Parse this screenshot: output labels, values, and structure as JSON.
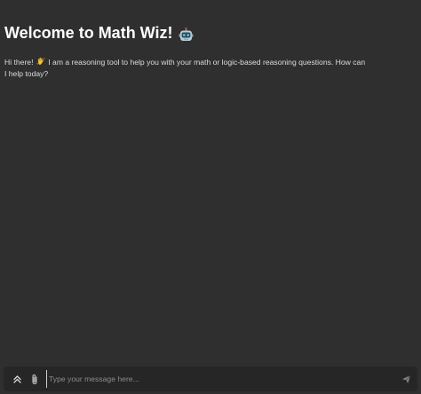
{
  "chat": {
    "title": "Welcome to Math Wiz!",
    "title_icon": "robot-icon",
    "intro_before_icon": "Hi there!",
    "intro_icon": "waving-hand-icon",
    "intro_after_icon": "I am a reasoning tool to help you with your math or logic-based reasoning questions. How can I help today?"
  },
  "composer": {
    "placeholder": "Type your message here...",
    "value": "",
    "icons": [
      "expand-icon",
      "paperclip-icon",
      "send-icon"
    ]
  },
  "colors": {
    "background": "#2f2f2f",
    "composer_background": "#262626",
    "text": "#e8e8e8",
    "placeholder": "#8c8c8c"
  }
}
